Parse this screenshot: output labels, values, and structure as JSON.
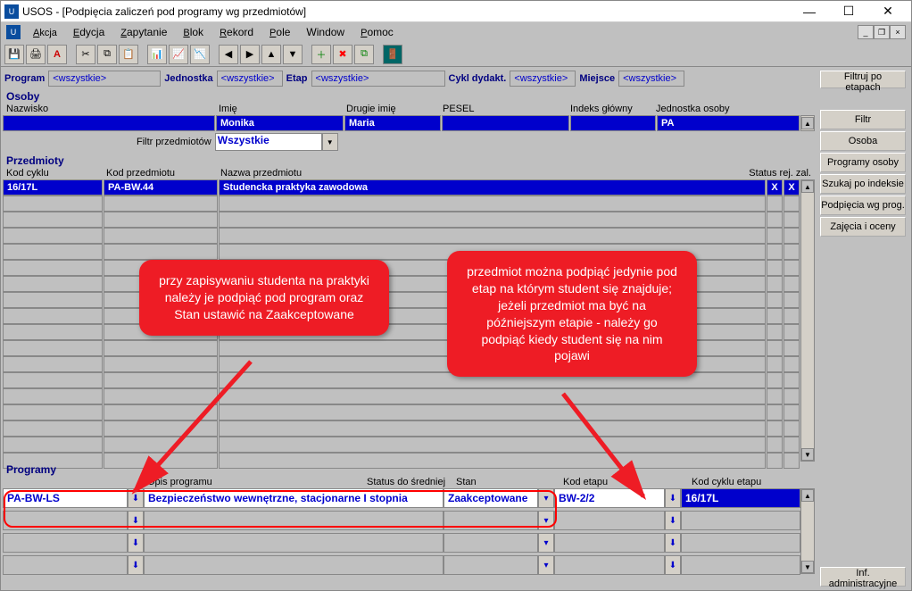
{
  "window": {
    "title": "USOS - [Podpięcia zaliczeń pod programy wg przedmiotów]"
  },
  "menu": {
    "akcja": "Akcja",
    "edycja": "Edycja",
    "zapytanie": "Zapytanie",
    "blok": "Blok",
    "rekord": "Rekord",
    "pole": "Pole",
    "window": "Window",
    "pomoc": "Pomoc"
  },
  "filters": {
    "program_lbl": "Program",
    "program_val": "<wszystkie>",
    "jedn_lbl": "Jednostka",
    "jedn_val": "<wszystkie>",
    "etap_lbl": "Etap",
    "etap_val": "<wszystkie>",
    "cykl_lbl": "Cykl dydakt.",
    "cykl_val": "<wszystkie>",
    "miejsce_lbl": "Miejsce",
    "miejsce_val": "<wszystkie>",
    "filtruj_btn": "Filtruj po etapach"
  },
  "person": {
    "section": "Osoby",
    "hdr": {
      "nazwisko": "Nazwisko",
      "imie": "Imię",
      "drugie": "Drugie imię",
      "pesel": "PESEL",
      "indeks": "Indeks główny",
      "jedn": "Jednostka osoby"
    },
    "row": {
      "nazwisko": "",
      "imie": "Monika",
      "drugie": "Maria",
      "pesel": "",
      "indeks": "",
      "jedn": "PA"
    }
  },
  "subfilter": {
    "lbl": "Filtr przedmiotów",
    "val": "Wszystkie"
  },
  "subjects": {
    "section": "Przedmioty",
    "hdr": {
      "cykl": "Kod cyklu",
      "kod": "Kod przedmiotu",
      "nazwa": "Nazwa przedmiotu",
      "status": "Status rej. zal."
    },
    "row": {
      "cykl": "16/17L",
      "kod": "PA-BW.44",
      "nazwa": "Studencka praktyka zawodowa",
      "s1": "X",
      "s2": "X"
    }
  },
  "programs": {
    "section": "Programy",
    "hdr": {
      "prog": "",
      "opis": "Opis programu",
      "status": "Status do średniej",
      "stan": "Stan",
      "kodet": "Kod etapu",
      "kodcyk": "Kod cyklu etapu"
    },
    "row": {
      "prog": "PA-BW-LS",
      "opis": "Bezpieczeństwo wewnętrzne, stacjonarne I stopnia",
      "status": "",
      "stan": "Zaakceptowane",
      "kodet": "BW-2/2",
      "kodcyk": "16/17L"
    }
  },
  "rightbtns": {
    "filtr": "Filtr",
    "osoba": "Osoba",
    "progos": "Programy osoby",
    "szukaj": "Szukaj po indeksie",
    "podp": "Podpięcia wg prog.",
    "zajoc": "Zajęcia i oceny",
    "infadm": "Inf. administracyjne"
  },
  "callouts": {
    "left": "przy zapisywaniu studenta na praktyki należy je podpiąć pod program oraz Stan ustawić na Zaakceptowane",
    "right": "przedmiot można podpiąć jedynie pod etap na którym student się znajduje; jeżeli przedmiot ma być na późniejszym etapie - należy go podpiąć kiedy student się na nim pojawi"
  }
}
